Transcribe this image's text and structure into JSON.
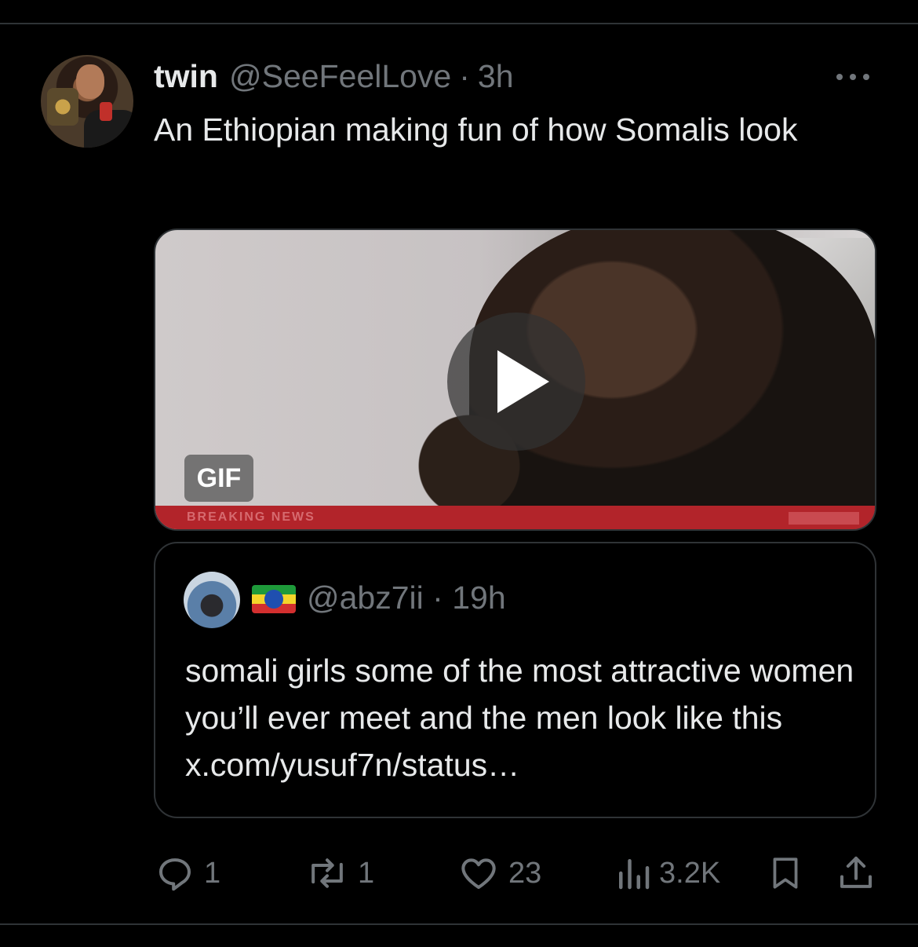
{
  "tweet": {
    "author_name": "twin",
    "author_handle": "@SeeFeelLove",
    "separator": "·",
    "time": "3h",
    "text": "An Ethiopian making fun of how Somalis look"
  },
  "media": {
    "badge": "GIF",
    "banner_text": "BREAKING NEWS"
  },
  "quote": {
    "handle": "@abz7ii",
    "separator": "·",
    "time": "19h",
    "text": "somali girls some of the most attractive women you’ll ever meet and the men look like this x.com/yusuf7n/status…"
  },
  "actions": {
    "replies": "1",
    "reposts": "1",
    "likes": "23",
    "views": "3.2K"
  },
  "icons": {
    "more": "more-horizontal-icon",
    "play": "play-icon",
    "reply": "reply-icon",
    "repost": "repost-icon",
    "like": "heart-icon",
    "views": "views-icon",
    "bookmark": "bookmark-icon",
    "share": "share-icon"
  },
  "colors": {
    "background": "#000000",
    "text": "#e7e9ea",
    "secondary": "#71767b",
    "border": "#2f3336"
  }
}
